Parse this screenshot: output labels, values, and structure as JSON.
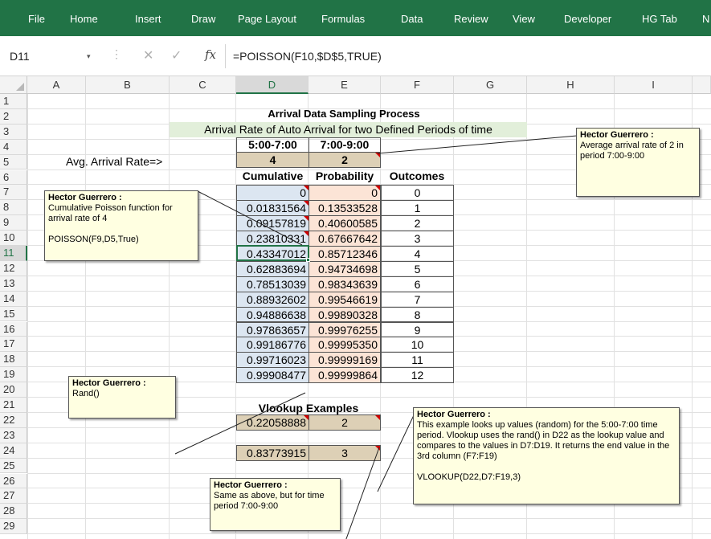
{
  "ribbon": {
    "tabs": [
      "File",
      "Home",
      "Insert",
      "Draw",
      "Page Layout",
      "Formulas",
      "Data",
      "Review",
      "View",
      "Developer",
      "HG Tab",
      "N"
    ]
  },
  "formula_bar": {
    "name_box": "D11",
    "fx_label": "fx",
    "formula": "=POISSON(F10,$D$5,TRUE)"
  },
  "grid": {
    "columns": [
      "A",
      "B",
      "C",
      "D",
      "E",
      "F",
      "G",
      "H",
      "I"
    ],
    "rows": [
      "1",
      "2",
      "3",
      "4",
      "5",
      "6",
      "7",
      "8",
      "9",
      "10",
      "11",
      "12",
      "13",
      "14",
      "15",
      "16",
      "17",
      "18",
      "19",
      "20",
      "21",
      "22",
      "23",
      "24",
      "25",
      "26",
      "27",
      "28",
      "29"
    ],
    "selected_cell": "D11"
  },
  "sheet": {
    "title": "Arrival Data Sampling Process",
    "subtitle": "Arrival Rate of Auto Arrival for two Defined Periods of time",
    "period1": "5:00-7:00",
    "period2": "7:00-9:00",
    "avg_label": "Avg. Arrival Rate=>",
    "rate1": "4",
    "rate2": "2",
    "header_cumulative": "Cumulative",
    "header_probability": "Probability",
    "header_outcomes": "Outcomes",
    "table": [
      [
        "0",
        "0",
        "0"
      ],
      [
        "0.01831564",
        "0.13533528",
        "1"
      ],
      [
        "0.09157819",
        "0.40600585",
        "2"
      ],
      [
        "0.23810331",
        "0.67667642",
        "3"
      ],
      [
        "0.43347012",
        "0.85712346",
        "4"
      ],
      [
        "0.62883694",
        "0.94734698",
        "5"
      ],
      [
        "0.78513039",
        "0.98343639",
        "6"
      ],
      [
        "0.88932602",
        "0.99546619",
        "7"
      ],
      [
        "0.94886638",
        "0.99890328",
        "8"
      ],
      [
        "0.97863657",
        "0.99976255",
        "9"
      ],
      [
        "0.99186776",
        "0.99995350",
        "10"
      ],
      [
        "0.99716023",
        "0.99999169",
        "11"
      ],
      [
        "0.99908477",
        "0.99999864",
        "12"
      ]
    ],
    "vlookup_title": "Vlookup Examples",
    "vlookup1_value": "0.22058888",
    "vlookup1_result": "2",
    "vlookup2_value": "0.83773915",
    "vlookup2_result": "3"
  },
  "comments": {
    "author": "Hector Guerrero :",
    "note_e5": "Average arrival rate of 2 in period 7:00-9:00",
    "note_d8": "Cumulative Poisson function for arrival rate of 4\n\nPOISSON(F9,D5,True)",
    "note_d19": "Rand()",
    "note_e22": "This example looks up values (random) for the 5:00-7:00 time period.  Vlookup uses the rand() in D22 as the lookup value and compares to the values in D7:D19.  It returns the end value in the 3rd column (F7:F19)\n\n          VLOOKUP(D22,D7:F19,3)",
    "note_e24": "Same as above, but for time period 7:00-9:00"
  }
}
